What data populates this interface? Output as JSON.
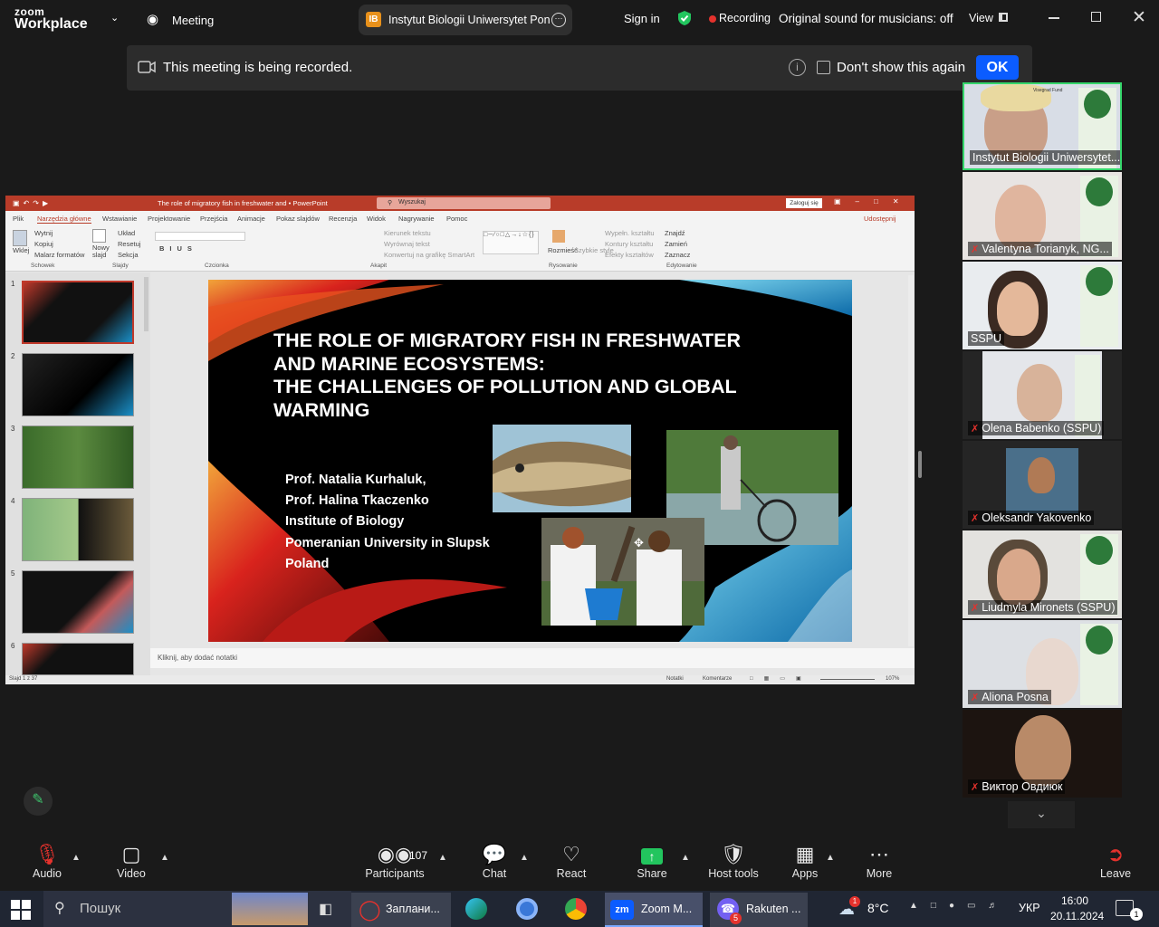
{
  "topbar": {
    "brand_line1": "zoom",
    "brand_line2": "Workplace",
    "meeting_label": "Meeting",
    "meeting_badge": "IB",
    "meeting_name": "Instytut Biologii Uniwersytet Pon",
    "sign_in": "Sign in",
    "recording": "Recording",
    "sound": "Original sound for musicians: off",
    "view": "View"
  },
  "notice": {
    "text": "This meeting is being recorded.",
    "dont_show": "Don't show this again",
    "ok": "OK"
  },
  "ppt": {
    "window_title": "The role of migratory fish in freshwater and  •  PowerPoint",
    "search": "Wyszukaj",
    "login": "Zaloguj się",
    "tabs": [
      "Plik",
      "Narzędzia główne",
      "Wstawianie",
      "Projektowanie",
      "Przejścia",
      "Animacje",
      "Pokaz slajdów",
      "Recenzja",
      "Widok",
      "Nagrywanie",
      "Pomoc"
    ],
    "share": "Udostępnij",
    "ribbon": {
      "paste": "Wklej",
      "cut": "Wytnij",
      "copy": "Kopiuj",
      "format_painter": "Malarz formatów",
      "new_slide": "Nowy slajd",
      "layout": "Układ",
      "reset": "Resetuj",
      "section": "Sekcja",
      "text_direction": "Kierunek tekstu",
      "align_text": "Wyrównaj tekst",
      "smartart": "Konwertuj na grafikę SmartArt",
      "arrange": "Rozmieść",
      "quick_styles": "Szybkie style",
      "fill": "Wypełn. kształtu",
      "outline": "Kontury kształtu",
      "effects": "Efekty kształtów",
      "find": "Znajdź",
      "replace": "Zamień",
      "select": "Zaznacz",
      "groups": [
        "Schowek",
        "Slajdy",
        "Czcionka",
        "Akapit",
        "Rysowanie",
        "Edytowanie"
      ]
    },
    "slide": {
      "title_lines": [
        "THE ROLE OF MIGRATORY FISH IN FRESHWATER",
        "AND MARINE ECOSYSTEMS:",
        "THE CHALLENGES OF POLLUTION AND GLOBAL",
        "WARMING"
      ],
      "authors": [
        "Prof. Natalia Kurhaluk,",
        "Prof. Halina Tkaczenko",
        "Institute of Biology",
        "Pomeranian University in Slupsk",
        "Poland"
      ]
    },
    "thumb_numbers": [
      "1",
      "2",
      "3",
      "4",
      "5",
      "6"
    ],
    "notes_placeholder": "Kliknij, aby dodać notatki",
    "status_left": "Slajd 1 z 37",
    "status_notes": "Notatki",
    "status_comments": "Komentarze",
    "zoom": "107%"
  },
  "participants": [
    {
      "name": "Instytut Biologii Uniwersytet...",
      "muted": false
    },
    {
      "name": "Valentyna Torianyk, NG...",
      "muted": true
    },
    {
      "name": "SSPU",
      "muted": false
    },
    {
      "name": "Olena Babenko (SSPU)",
      "muted": true
    },
    {
      "name": "Oleksandr Yakovenko",
      "muted": true
    },
    {
      "name": "Liudmyla Mironets (SSPU)",
      "muted": true
    },
    {
      "name": "Aliona Posna",
      "muted": true
    },
    {
      "name": "Виктор Овдиюк",
      "muted": true
    }
  ],
  "vf_label": "Visegrad Fund",
  "toolbar": {
    "audio": "Audio",
    "video": "Video",
    "participants": "Participants",
    "participants_count": "107",
    "chat": "Chat",
    "react": "React",
    "share": "Share",
    "host_tools": "Host tools",
    "apps": "Apps",
    "more": "More",
    "leave": "Leave"
  },
  "taskbar": {
    "search": "Пошук",
    "app1": "Заплани...",
    "app2": "Zoom M...",
    "app3": "Rakuten ...",
    "viber_badge": "5",
    "weather": "8°C",
    "weather_badge": "1",
    "lang": "УКР",
    "time": "16:00",
    "date": "20.11.2024",
    "notif_count": "1"
  },
  "colors": {
    "zoom_blue": "#0b5cff",
    "share_green": "#22c55e",
    "ppt_red": "#b83c29",
    "active_border": "#35d66b"
  }
}
